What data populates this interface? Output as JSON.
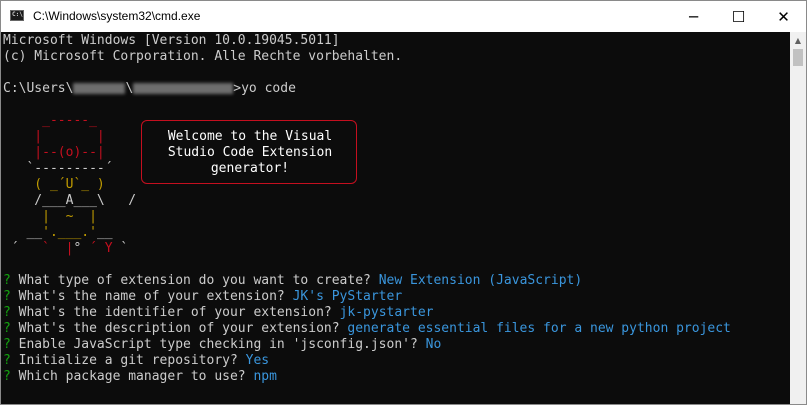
{
  "window": {
    "title": "C:\\Windows\\system32\\cmd.exe",
    "icon_text": "C:\\",
    "controls": {
      "minimize": "─",
      "maximize": "☐",
      "close": "✕"
    }
  },
  "console": {
    "banner_line1": "Microsoft Windows [Version 10.0.19045.5011]",
    "banner_line2": "(c) Microsoft Corporation. Alle Rechte vorbehalten.",
    "prompt_prefix": "C:\\Users\\",
    "prompt_sep": "\\",
    "command": ">yo code",
    "bubble_lines": [
      "Welcome to the Visual",
      "Studio Code Extension",
      "generator!"
    ],
    "questions": [
      {
        "mark": "?",
        "q": " What type of extension do you want to create? ",
        "a": "New Extension (JavaScript)"
      },
      {
        "mark": "?",
        "q": " What's the name of your extension? ",
        "a": "JK's PyStarter"
      },
      {
        "mark": "?",
        "q": " What's the identifier of your extension? ",
        "a": "jk-pystarter"
      },
      {
        "mark": "?",
        "q": " What's the description of your extension? ",
        "a": "generate essential files for a new python project"
      },
      {
        "mark": "?",
        "q": " Enable JavaScript type checking in 'jsconfig.json'? ",
        "a": "No"
      },
      {
        "mark": "?",
        "q": " Initialize a git repository? ",
        "a": "Yes"
      },
      {
        "mark": "?",
        "q": " Which package manager to use? ",
        "a": "npm"
      }
    ]
  },
  "colors": {
    "background": "#0c0c0c",
    "text": "#cccccc",
    "question_mark": "#13a10e",
    "answer": "#3a96dd",
    "hat": "#c50f1f",
    "body": "#c19c00",
    "bubble_border": "#c50f1f"
  }
}
